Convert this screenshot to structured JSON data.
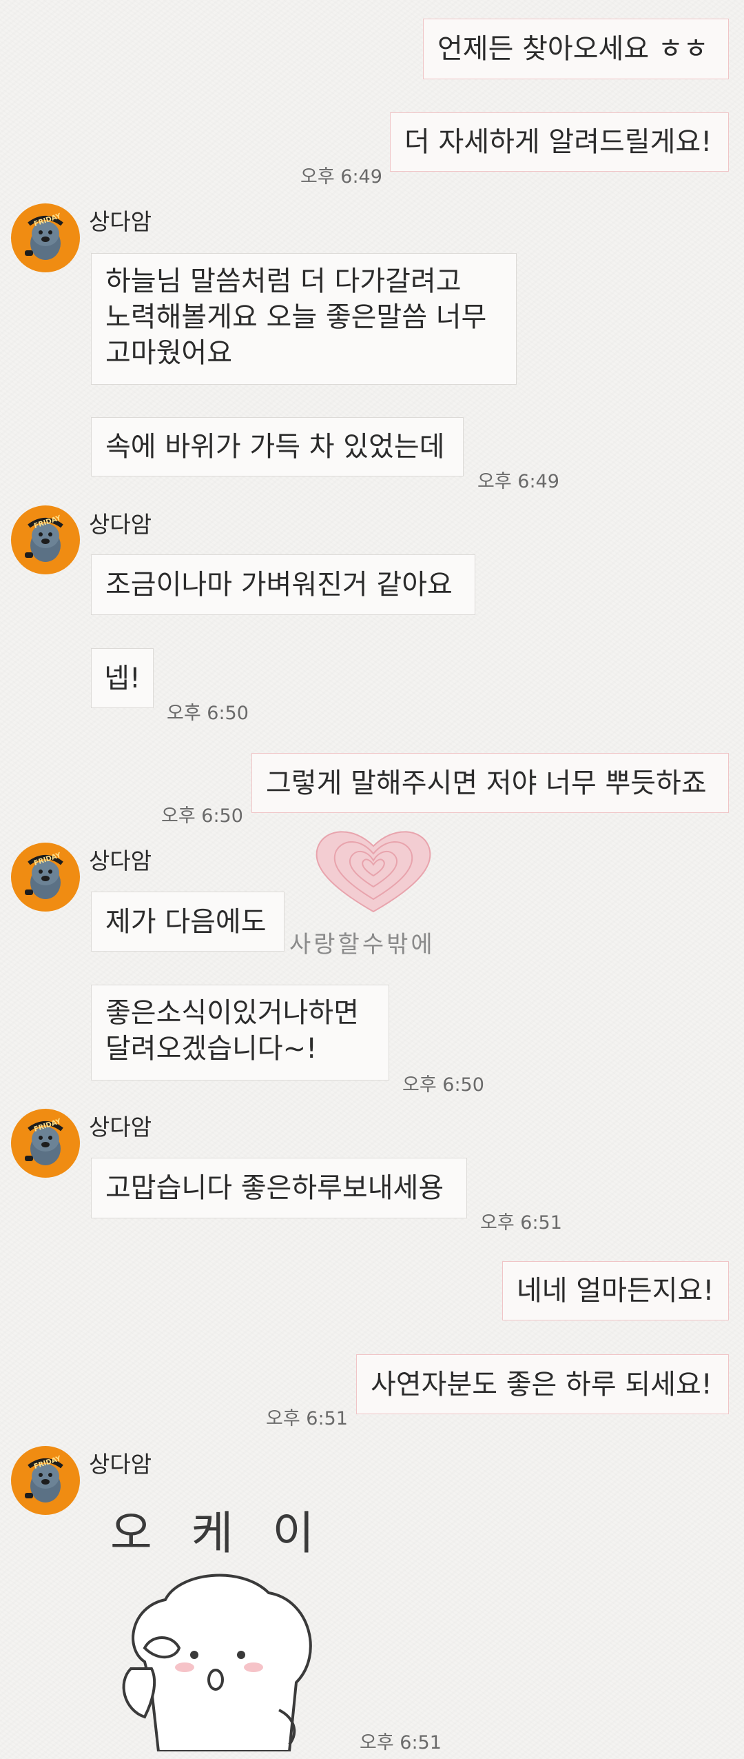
{
  "sender_name": "상다암",
  "avatar_text": "FRIDAY",
  "messages": {
    "m1": "언제든 찾아오세요 ㅎㅎ",
    "m2": "더 자세하게 알려드릴게요!",
    "t2": "오후 6:49",
    "r1_l1": "하늘님 말씀처럼 더 다가갈려고",
    "r1_l2": "노력해볼게요 오늘 좋은말씀 너무",
    "r1_l3": "고마웠어요",
    "r2": "속에 바위가 가득 차 있었는데",
    "t3": "오후 6:49",
    "r3": "조금이나마 가벼워진거 같아요",
    "r4": "넵!",
    "t4": "오후 6:50",
    "m3": "그렇게 말해주시면 저야 너무 뿌듯하죠",
    "t5": "오후 6:50",
    "r5": "제가 다음에도",
    "r6_l1": "좋은소식이있거나하면",
    "r6_l2": "달려오겠습니다~!",
    "t6": "오후 6:50",
    "r7": "고맙습니다 좋은하루보내세용",
    "t7": "오후 6:51",
    "m4": "네네 얼마든지요!",
    "m5": "사연자분도 좋은 하루 되세요!",
    "t8": "오후 6:51",
    "t9": "오후 6:51"
  },
  "stamp": {
    "text": "사랑할수밖에",
    "color": "#e8a4ad"
  },
  "sticker": {
    "text": "오 케 이"
  },
  "colors": {
    "avatar_bg": "#f08c12",
    "my_bubble_border": "#f0c5c7",
    "bubble_border": "#dcdad7"
  }
}
